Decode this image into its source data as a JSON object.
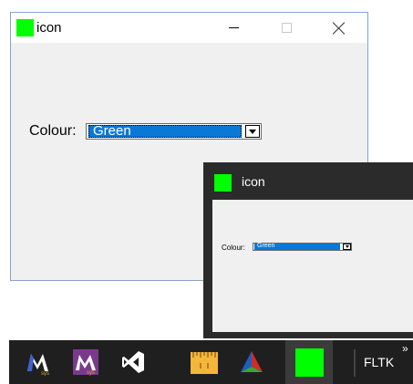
{
  "main_window": {
    "title": "icon",
    "colour_label": "Colour:",
    "colour_value": "Green"
  },
  "preview_window": {
    "title": "icon",
    "colour_label": "Colour:",
    "colour_value": "Green"
  },
  "taskbar": {
    "items": [
      {
        "icon": "msys2-mingw-icon"
      },
      {
        "icon": "msys2-icon"
      },
      {
        "icon": "visual-studio-icon"
      },
      {
        "icon": "ruler-app-icon"
      },
      {
        "icon": "cmake-icon"
      },
      {
        "icon": "fltk-app-icon"
      }
    ],
    "toolbar_label": "FLTK",
    "overflow_glyph": "»"
  },
  "colors": {
    "app_icon": "#00ff00",
    "selection": "#0a78d7",
    "taskbar": "#1f1f1f"
  }
}
